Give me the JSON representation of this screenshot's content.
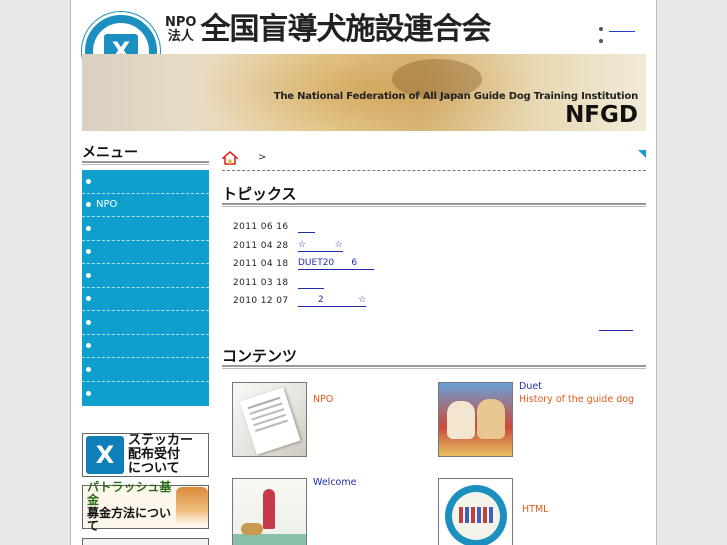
{
  "header": {
    "npo_label": "NPO\n法人",
    "org_title": "全国盲導犬施設連合会",
    "banner_english": "The National Federation of All Japan Guide Dog Training Institution",
    "banner_abbr": "NFGD"
  },
  "sidebar": {
    "menu_title": "メニュー",
    "items": [
      {
        "label": ""
      },
      {
        "label": "NPO"
      },
      {
        "label": ""
      },
      {
        "label": ""
      },
      {
        "label": ""
      },
      {
        "label": ""
      },
      {
        "label": ""
      },
      {
        "label": ""
      },
      {
        "label": ""
      },
      {
        "label": ""
      }
    ],
    "banners": [
      {
        "text": "ステッカー\n配布受付\nについて"
      },
      {
        "text": "パトラッシュ基金",
        "sub": "募金方法について"
      }
    ]
  },
  "breadcrumb": {
    "separator": ">"
  },
  "topics": {
    "title": "トピックス",
    "rows": [
      {
        "date": "2011 06 16",
        "link": "      "
      },
      {
        "date": "2011 04 28",
        "link": "☆          ☆"
      },
      {
        "date": "2011 04 18",
        "link": "DUET20      6      "
      },
      {
        "date": "2011 03 18",
        "link": "         "
      },
      {
        "date": "2010 12 07",
        "link": "       2            ☆"
      }
    ]
  },
  "contents": {
    "title": "コンテンツ",
    "items": [
      {
        "line1": "NPO",
        "line2": ""
      },
      {
        "line1": "Duet",
        "line2": "History of the guide dog"
      },
      {
        "line1": "Welcome",
        "line2": ""
      },
      {
        "line1": "HTML",
        "line2": ""
      }
    ]
  },
  "colors": {
    "menu_bg": "#0e9fcd",
    "link": "#1f2ea8",
    "accent_orange": "#e05a1a"
  }
}
